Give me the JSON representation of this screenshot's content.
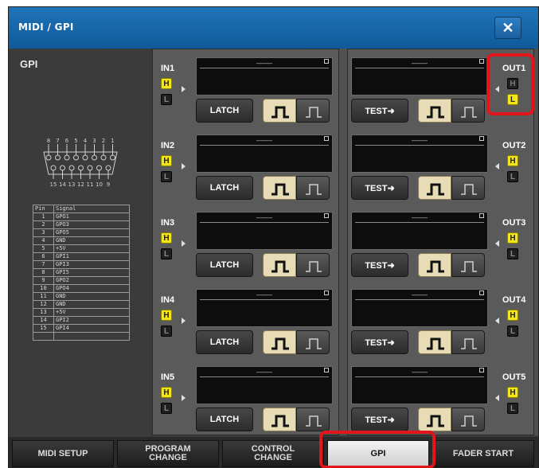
{
  "window": {
    "title": "MIDI / GPI",
    "close_symbol": "✕"
  },
  "left": {
    "title": "GPI",
    "connector_top_pins": [
      "8",
      "7",
      "6",
      "5",
      "4",
      "3",
      "2",
      "1"
    ],
    "connector_bottom_pins": [
      "15",
      "14",
      "13",
      "12",
      "11",
      "10",
      "9"
    ],
    "pin_table": {
      "headers": [
        "Pin",
        "Signal"
      ],
      "rows": [
        [
          "1",
          "GPO1"
        ],
        [
          "2",
          "GPO3"
        ],
        [
          "3",
          "GPO5"
        ],
        [
          "4",
          "GND"
        ],
        [
          "5",
          "+5V"
        ],
        [
          "6",
          "GPI1"
        ],
        [
          "7",
          "GPI3"
        ],
        [
          "8",
          "GPI5"
        ],
        [
          "9",
          "GPO2"
        ],
        [
          "10",
          "GPO4"
        ],
        [
          "11",
          "GND"
        ],
        [
          "12",
          "GND"
        ],
        [
          "13",
          "+5V"
        ],
        [
          "14",
          "GPI2"
        ],
        [
          "15",
          "GPI4"
        ]
      ]
    }
  },
  "inputs": [
    {
      "label": "IN1",
      "h": "H",
      "l": "L",
      "display": "––––",
      "button": "LATCH"
    },
    {
      "label": "IN2",
      "h": "H",
      "l": "L",
      "display": "––––",
      "button": "LATCH"
    },
    {
      "label": "IN3",
      "h": "H",
      "l": "L",
      "display": "––––",
      "button": "LATCH"
    },
    {
      "label": "IN4",
      "h": "H",
      "l": "L",
      "display": "––––",
      "button": "LATCH"
    },
    {
      "label": "IN5",
      "h": "H",
      "l": "L",
      "display": "––––",
      "button": "LATCH"
    }
  ],
  "outputs": [
    {
      "label": "OUT1",
      "h": "H",
      "l": "L",
      "state": "L",
      "display": "––––",
      "button": "TEST➜"
    },
    {
      "label": "OUT2",
      "h": "H",
      "l": "L",
      "state": "H",
      "display": "––––",
      "button": "TEST➜"
    },
    {
      "label": "OUT3",
      "h": "H",
      "l": "L",
      "state": "H",
      "display": "––––",
      "button": "TEST➜"
    },
    {
      "label": "OUT4",
      "h": "H",
      "l": "L",
      "state": "H",
      "display": "––––",
      "button": "TEST➜"
    },
    {
      "label": "OUT5",
      "h": "H",
      "l": "L",
      "state": "H",
      "display": "––––",
      "button": "TEST➜"
    }
  ],
  "tabs": [
    {
      "label": "MIDI SETUP",
      "active": false
    },
    {
      "label": "PROGRAM\nCHANGE",
      "active": false
    },
    {
      "label": "CONTROL\nCHANGE",
      "active": false
    },
    {
      "label": "GPI",
      "active": true
    },
    {
      "label": "FADER START",
      "active": false
    }
  ],
  "colors": {
    "title_bar": "#1565a8",
    "indicator_on": "#f2e619",
    "highlight": "#e3141b"
  }
}
